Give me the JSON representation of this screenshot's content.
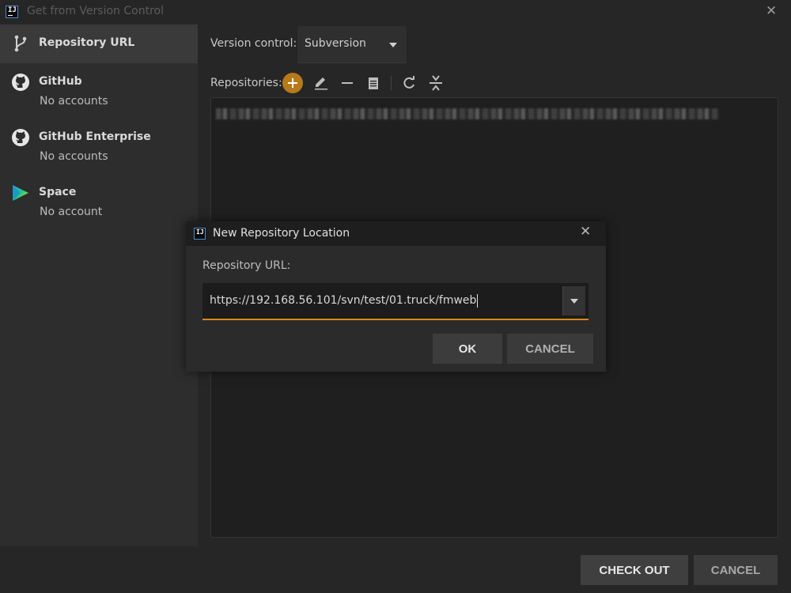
{
  "window": {
    "title": "Get from Version Control"
  },
  "sidebar": {
    "items": [
      {
        "title": "Repository URL",
        "icon": "vcs-branch-icon"
      },
      {
        "title": "GitHub",
        "subtitle": "No accounts",
        "icon": "github-icon"
      },
      {
        "title": "GitHub Enterprise",
        "subtitle": "No accounts",
        "icon": "github-icon"
      },
      {
        "title": "Space",
        "subtitle": "No account",
        "icon": "space-icon"
      }
    ]
  },
  "main": {
    "version_control_label": "Version control:",
    "version_control_value": "Subversion",
    "repositories_label": "Repositories:",
    "check_out_label": "CHECK OUT",
    "cancel_label": "CANCEL"
  },
  "dialog": {
    "title": "New Repository Location",
    "url_label": "Repository URL:",
    "url_value": "https://192.168.56.101/svn/test/01.truck/fmweb",
    "ok_label": "OK",
    "cancel_label": "CANCEL"
  },
  "colors": {
    "accent": "#d68a17",
    "add_button": "#b77a1a"
  }
}
